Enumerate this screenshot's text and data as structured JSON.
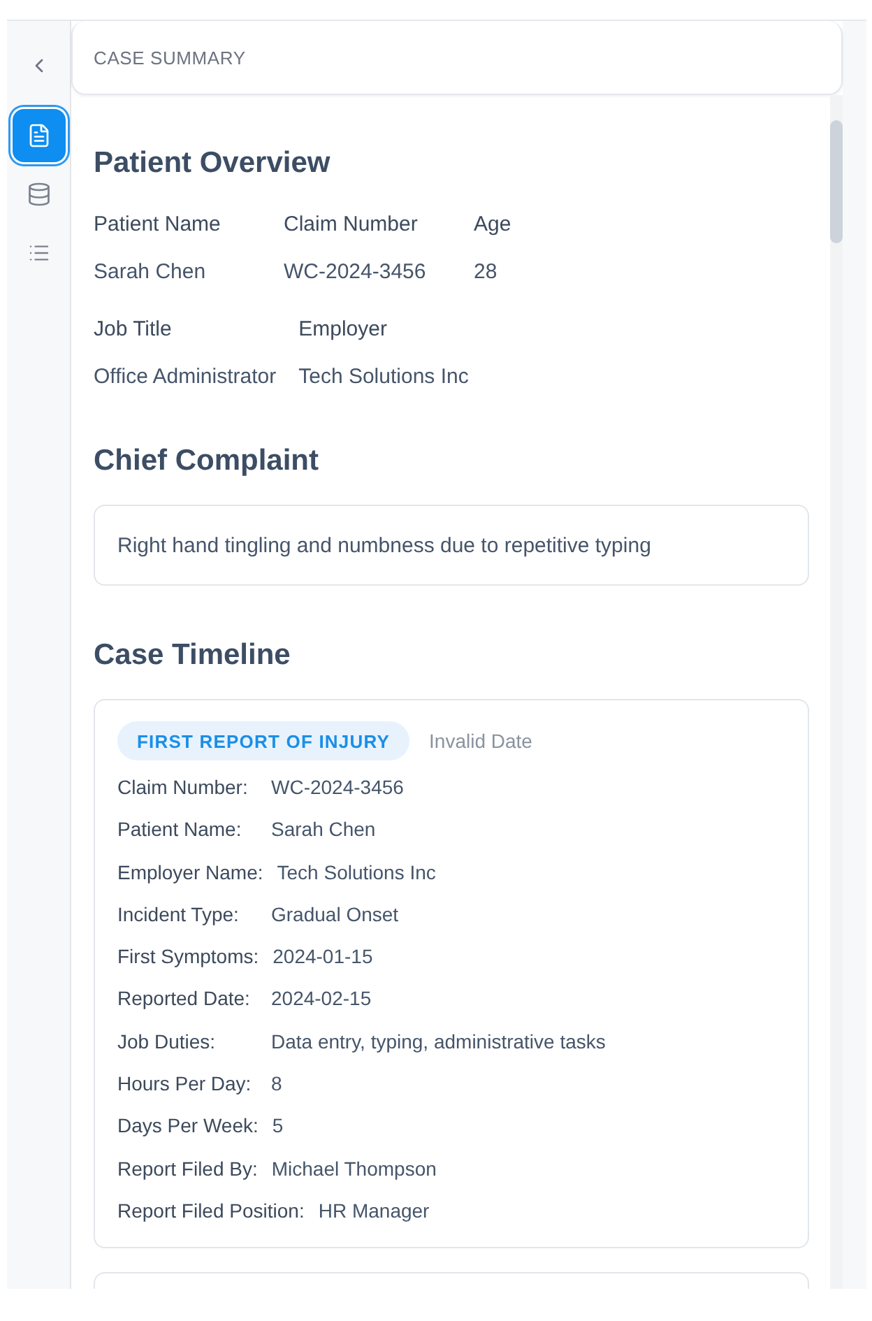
{
  "sidebar": {
    "items": [
      {
        "selected": true
      },
      {
        "selected": false
      },
      {
        "selected": false
      }
    ]
  },
  "header": {
    "title": "CASE SUMMARY"
  },
  "patient_overview": {
    "title": "Patient Overview",
    "rows": [
      {
        "fields": [
          {
            "label": "Patient Name",
            "value": "Sarah Chen"
          },
          {
            "label": "Claim Number",
            "value": "WC-2024-3456"
          },
          {
            "label": "Age",
            "value": "28"
          }
        ]
      },
      {
        "fields": [
          {
            "label": "Job Title",
            "value": "Office Administrator"
          },
          {
            "label": "Employer",
            "value": "Tech Solutions Inc"
          }
        ]
      }
    ]
  },
  "chief_complaint": {
    "title": "Chief Complaint",
    "text": "Right hand tingling and numbness due to repetitive typing"
  },
  "case_timeline": {
    "title": "Case Timeline",
    "entries": [
      {
        "type": "FIRST REPORT OF INJURY",
        "date": "Invalid Date",
        "fields": [
          {
            "label": "Claim Number:",
            "value": "WC-2024-3456"
          },
          {
            "label": "Patient Name:",
            "value": "Sarah Chen"
          },
          {
            "label": "Employer Name:",
            "value": "Tech Solutions Inc"
          },
          {
            "label": "Incident Type:",
            "value": "Gradual Onset"
          },
          {
            "label": "First Symptoms:",
            "value": "2024-01-15"
          },
          {
            "label": "Reported Date:",
            "value": "2024-02-15"
          },
          {
            "label": "Job Duties:",
            "value": "Data entry, typing, administrative tasks"
          },
          {
            "label": "Hours Per Day:",
            "value": "8"
          },
          {
            "label": "Days Per Week:",
            "value": "5"
          },
          {
            "label": "Report Filed By:",
            "value": "Michael Thompson"
          },
          {
            "label": "Report Filed Position:",
            "value": "HR Manager"
          }
        ]
      }
    ],
    "next_entry_cut_off": true
  }
}
